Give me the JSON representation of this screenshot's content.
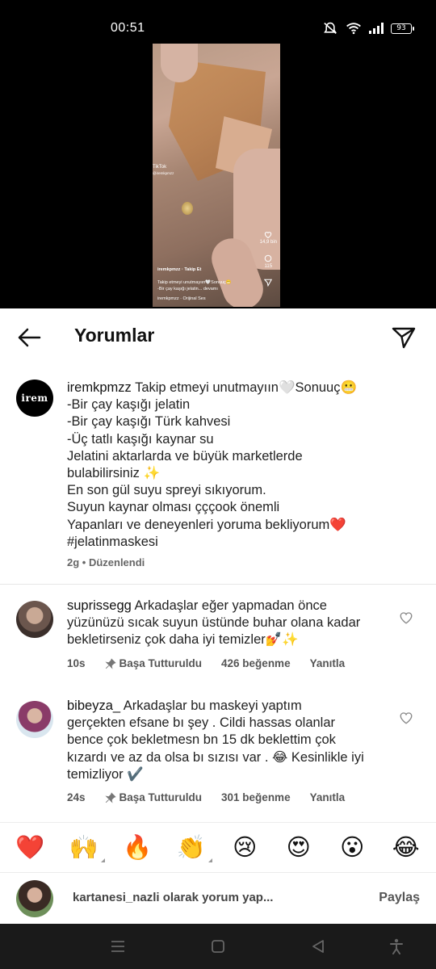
{
  "status_bar": {
    "time": "00:51",
    "battery": "93"
  },
  "video": {
    "tiktok_label": "TikTok",
    "tiktok_user": "@iremkpmzz",
    "like_count": "14,9 bin",
    "comment_count": "115",
    "overlay_user": "iremkpmzz · Takip Et",
    "overlay_caption_1": "Takip etmeyi unutmayıın🤍Sonuuç😬",
    "overlay_caption_2": "-Bir çay kaşığı jelatin... devamı",
    "overlay_sound": "iremkpmzz · Orijinal Ses"
  },
  "header": {
    "title": "Yorumlar"
  },
  "caption": {
    "avatar_text": "irem",
    "username": "iremkpmzz",
    "lines": [
      "Takip etmeyi unutmayıın🤍Sonuuç😬",
      "-Bir çay kaşığı jelatin",
      "-Bir çay kaşığı Türk kahvesi",
      "-Üç tatlı kaşığı kaynar su",
      "Jelatini aktarlarda ve büyük marketlerde",
      "bulabilirsiniz ✨",
      "En son gül suyu spreyi sıkıyorum.",
      "Suyun kaynar olması çççook önemli",
      "Yapanları ve deneyenleri yoruma bekliyorum❤️",
      "#jelatinmaskesi"
    ],
    "meta": "2g • Düzenlendi"
  },
  "comments": [
    {
      "username": "suprissegg",
      "lines": [
        "Arkadaşlar eğer yapmadan önce",
        "yüzünüzü sıcak suyun üstünde buhar olana kadar",
        "bekletirseniz çok daha iyi temizler💅✨"
      ],
      "time": "10s",
      "pinned": "Başa Tutturuldu",
      "likes": "426 beğenme",
      "reply": "Yanıtla"
    },
    {
      "username": "bibeyza_",
      "lines": [
        "Arkadaşlar bu maskeyi yaptım",
        "gerçekten efsane bı şey .  Cildi hassas olanlar",
        "bence çok bekletmesn bn 15 dk beklettim çok",
        "kızardı ve az da olsa bı sızısı var . 😂 Kesinlikle iyi",
        "temizliyor ✔️"
      ],
      "time": "24s",
      "pinned": "Başa Tutturuldu",
      "likes": "301 beğenme",
      "reply": "Yanıtla"
    }
  ],
  "emoji_bar": [
    "❤️",
    "🙌",
    "🔥",
    "👏",
    "😢",
    "😍",
    "😮",
    "😂"
  ],
  "input": {
    "placeholder": "kartanesi_nazli olarak yorum yap...",
    "share_label": "Paylaş"
  },
  "colors": {
    "heart": "#ed4956",
    "sheet_bg": "#ffffff",
    "nav_bg": "#1a1a1a"
  }
}
